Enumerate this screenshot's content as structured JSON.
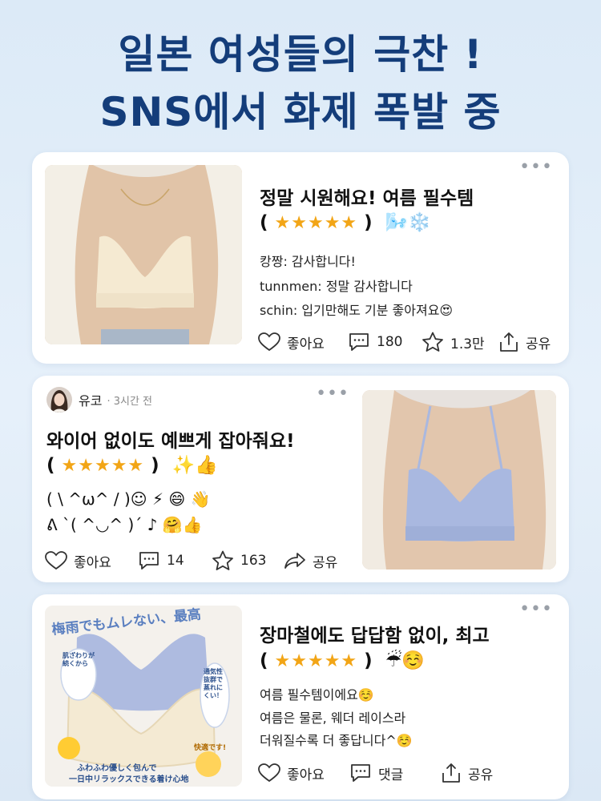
{
  "headline": {
    "line1": "일본 여성들의 극찬 !",
    "line2": "SNS에서 화제 폭발 중"
  },
  "accent_colors": {
    "headline": "#143d7a",
    "star": "#f2a516"
  },
  "posts": [
    {
      "title": "정말 시원해요! 여름 필수템",
      "rating_open": "(",
      "stars": "★★★★★",
      "rating_close": ")",
      "rating_emoji": "🌬️❄️",
      "comments": [
        "캉짱: 감사합니다!",
        "tunnmen: 정말 감사합니다",
        "schin: 입기만해도 기분 좋아져요😍"
      ],
      "actions": {
        "like": "좋아요",
        "comment": "180",
        "star": "1.3만",
        "share": "공유"
      },
      "more": "•••"
    },
    {
      "user": {
        "name": "유코",
        "time": "· 3시간 전"
      },
      "title": "와이어 없이도 예쁘게 잡아줘요!",
      "rating_open": "(",
      "stars": "★★★★★",
      "rating_close": ")",
      "rating_emoji": "✨👍",
      "kaomoji": [
        "( \\ ^ω^ / )☺︎ ⚡︎ 😄 👋",
        "ᕕ `( ^◡^ )´ ♪ 🤗👍"
      ],
      "actions": {
        "like": "좋아요",
        "comment": "14",
        "star": "163",
        "share": "공유"
      },
      "more": "•••"
    },
    {
      "title": "장마철에도 답답함 없이, 최고",
      "rating_open": "(",
      "stars": "★★★★★",
      "rating_close": ")",
      "rating_emoji": "☔☺️",
      "comments": [
        "여름 필수템이에요☺️",
        "여름은 물론, 웨더 레이스라",
        "더워질수록 더 좋답니다^☺️"
      ],
      "actions": {
        "like": "좋아요",
        "comment": "댓글",
        "share": "공유"
      },
      "more": "•••",
      "image_text": {
        "banner": "梅雨でもムレない、最高",
        "left_bubble": "肌ざわりが続くから",
        "right_bubble": "通気性抜群で蒸れにくい！",
        "badge": "快適です!",
        "bottom1": "ふわふわ優しく包んで",
        "bottom2": "一日中リラックスできる着け心地"
      }
    }
  ]
}
